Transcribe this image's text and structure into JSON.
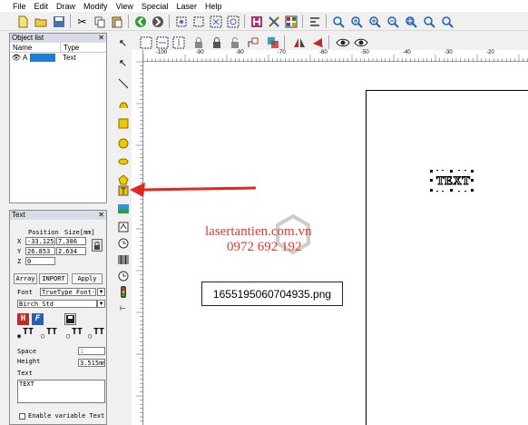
{
  "menu": [
    "File",
    "Edit",
    "Draw",
    "Modify",
    "View",
    "Special",
    "Laser",
    "Help"
  ],
  "object_list": {
    "title": "Object list",
    "col_name": "Name",
    "col_type": "Type",
    "rows": [
      {
        "name": "A",
        "type": "Text"
      }
    ]
  },
  "text_panel": {
    "title": "Text",
    "position_label": "Position",
    "size_label": "Size[mm]",
    "x_label": "X",
    "y_label": "Y",
    "z_label": "Z",
    "x_pos": "-33.125",
    "x_size": "7.386",
    "y_pos": "26.853",
    "y_size": "2.634",
    "z_pos": "0",
    "array_label": "Array",
    "inport_label": "INPORT",
    "apply_label": "Apply",
    "font_label": "Font",
    "font_type": "TrueType Font-2",
    "font_name": "Birch Std",
    "space_label": "Space",
    "space_value": "1",
    "height_label": "Height",
    "height_value": "3.515mm",
    "text_label": "Text",
    "text_value": "TEXT",
    "variable_label": "Enable variable Text"
  },
  "ruler_h_labels": [
    "-100",
    "-90",
    "-80",
    "-70",
    "-60",
    "-50",
    "-40",
    "-30",
    "-20"
  ],
  "canvas": {
    "watermark_site": "lasertantien.com.vn",
    "watermark_phone": "0972 692 192",
    "filename": "1655195060704935.png",
    "text_object": "TEXT"
  }
}
